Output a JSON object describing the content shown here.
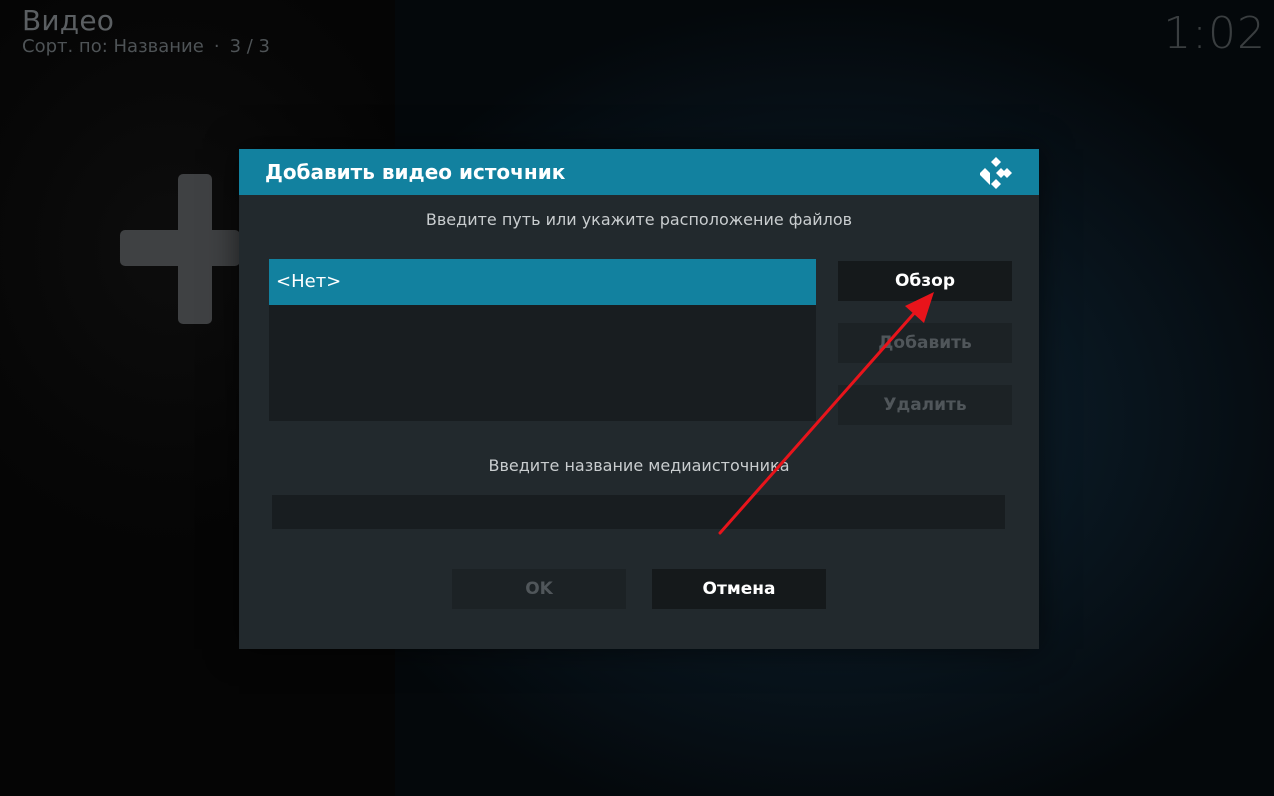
{
  "header": {
    "title": "Видео",
    "sort_label": "Сорт. по: Название",
    "separator": "·",
    "position": "3 / 3",
    "clock": "1:02"
  },
  "dialog": {
    "title": "Добавить видео источник",
    "logo_icon": "kodi-logo-icon",
    "path_hint": "Введите путь или укажите расположение файлов",
    "path_items": [
      "<Нет>"
    ],
    "buttons": {
      "browse": "Обзор",
      "add": "Добавить",
      "remove": "Удалить",
      "ok": "OK",
      "cancel": "Отмена"
    },
    "name_hint": "Введите название медиаисточника",
    "name_value": ""
  },
  "colors": {
    "accent": "#12819f",
    "dialog_bg": "#22292d",
    "annotation_arrow": "#e8141b"
  }
}
